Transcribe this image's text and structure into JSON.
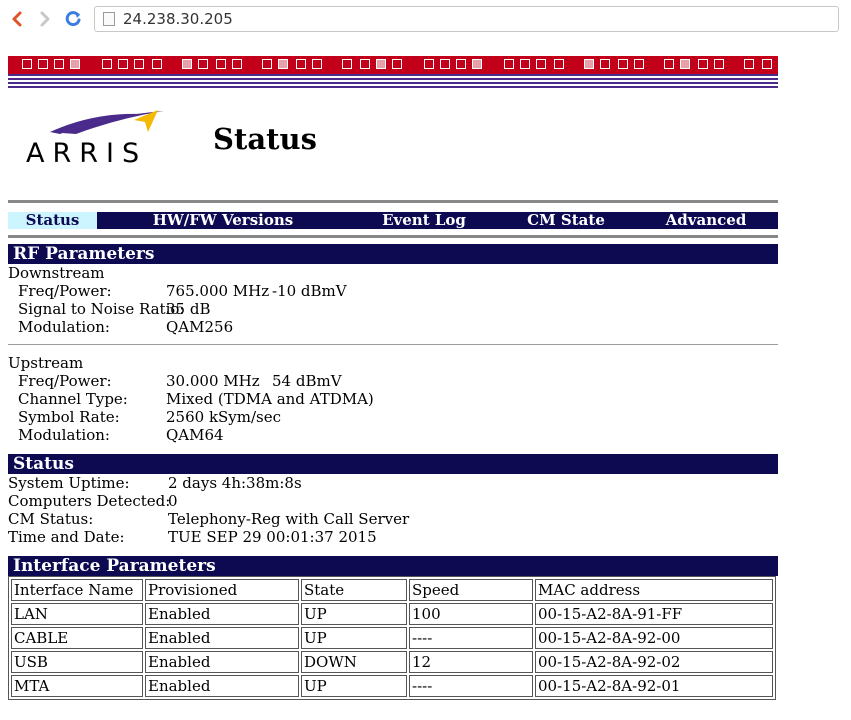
{
  "browser": {
    "url": "24.238.30.205",
    "icons": {
      "back": "back-arrow-icon",
      "forward": "forward-arrow-icon",
      "reload": "reload-icon",
      "page": "page-icon"
    },
    "colors": {
      "back": "#e0542a",
      "forward": "#c8c8c8",
      "reload": "#3b7de0"
    }
  },
  "brand": {
    "logo_text": "ARRIS",
    "colors": {
      "red": "#c2001a",
      "navy": "#0d0a52",
      "purple": "#4a2a8a",
      "tab_active_bg": "#ccf5ff",
      "logo_yellow": "#f5b800"
    }
  },
  "page": {
    "title": "Status"
  },
  "nav": {
    "tabs": [
      {
        "label": "Status",
        "active": true
      },
      {
        "label": "HW/FW Versions",
        "active": false
      },
      {
        "label": "Event Log",
        "active": false
      },
      {
        "label": "CM State",
        "active": false
      },
      {
        "label": "Advanced",
        "active": false
      }
    ]
  },
  "rf": {
    "heading": "RF Parameters",
    "downstream": {
      "title": "Downstream",
      "rows": [
        {
          "label": "Freq/Power:",
          "value": "765.000 MHz",
          "value2": "-10 dBmV"
        },
        {
          "label": "Signal to Noise Ratio:",
          "value": "35 dB"
        },
        {
          "label": "Modulation:",
          "value": "QAM256"
        }
      ]
    },
    "upstream": {
      "title": "Upstream",
      "rows": [
        {
          "label": "Freq/Power:",
          "value": "30.000 MHz",
          "value2": "54 dBmV"
        },
        {
          "label": "Channel Type:",
          "value": "Mixed (TDMA and ATDMA)"
        },
        {
          "label": "Symbol Rate:",
          "value": "2560 kSym/sec"
        },
        {
          "label": "Modulation:",
          "value": "QAM64"
        }
      ]
    }
  },
  "status": {
    "heading": "Status",
    "rows": [
      {
        "label": "System Uptime:",
        "value": "2 days 4h:38m:8s"
      },
      {
        "label": "Computers Detected:",
        "value": "0"
      },
      {
        "label": "CM Status:",
        "value": "Telephony-Reg with Call Server"
      },
      {
        "label": "Time and Date:",
        "value": "TUE SEP 29 00:01:37 2015"
      }
    ]
  },
  "interface": {
    "heading": "Interface Parameters",
    "columns": [
      "Interface Name",
      "Provisioned",
      "State",
      "Speed",
      "MAC address"
    ],
    "rows": [
      [
        "LAN",
        "Enabled",
        "UP",
        "100",
        "00-15-A2-8A-91-FF"
      ],
      [
        "CABLE",
        "Enabled",
        "UP",
        "----",
        "00-15-A2-8A-92-00"
      ],
      [
        "USB",
        "Enabled",
        "DOWN",
        "12",
        "00-15-A2-8A-92-02"
      ],
      [
        "MTA",
        "Enabled",
        "UP",
        "----",
        "00-15-A2-8A-92-01"
      ]
    ]
  }
}
